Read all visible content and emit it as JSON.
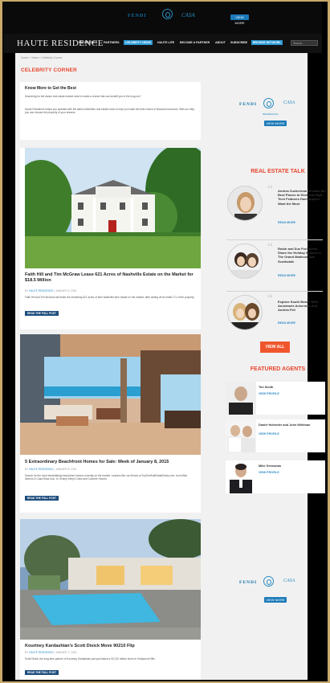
{
  "top_ad": {
    "brand_left": "FENDI",
    "brand_right": "CASA",
    "button": "VIEW MORE"
  },
  "header": {
    "brand": "HAUTE RESIDENCE",
    "nav": [
      "PROPERTIES",
      "PARTNERS",
      "CELEBRITY NEWS",
      "HAUTE LIFE",
      "BECOME A PARTNER",
      "ABOUT",
      "SUBSCRIBE"
    ],
    "register": "BROWSE NETWORK",
    "search_placeholder": "Search..."
  },
  "breadcrumb": "Home > News > Celebrity Corner",
  "page_title": "CELEBRITY CORNER",
  "intro": {
    "heading": "Know More to Get the Best",
    "p1": "Searching for the dance real estate market need to make a choice that can benefit you in the long run?",
    "p2": "Haute Residence keeps you updated with the latest celebrities real estate news to help you make the best choice of financial resources. With our help, you can choose the property of your dreams."
  },
  "articles": [
    {
      "title": "Faith Hill and Tim McGraw Lease 621 Acres of Nashville Estate on the Market for $18.5 Million",
      "by": "BY",
      "author": "HAUTE RESIDENCE",
      "date": "| JANUARY 8, 2015",
      "excerpt": "Faith Hill and Tim McGraw will lease the remaining 621 acres of their Nashville farm estate on the market, after selling off an initial 171 of the property.",
      "button": "READ THE FULL POST"
    },
    {
      "title": "5 Extraordinary Beachfront Homes for Sale: Week of January 8, 2015",
      "by": "BY",
      "author": "HAUTE RESIDENCE",
      "date": "| JANUARY 8, 2015",
      "excerpt": "Search for the most breathtaking beachfront homes currently on the market. Leaders like our friends at TopTenRealEstateDeals.com, from Mike Morrow & Casa Rosa Icon, to Tommy Kirby's Cabo and Canover Homes.",
      "button": "READ THE FULL POST"
    },
    {
      "title": "Kourtney Kardashian's Scott Disick Move 90210 Flip",
      "by": "BY",
      "author": "HAUTE RESIDENCE",
      "date": "| JANUARY 7, 2015",
      "excerpt": "Scott Disick, the long-time partner of Kourtney Kardashian just purchased a 90,210 million home in Hollywood Hills.",
      "button": "READ THE FULL POST"
    }
  ],
  "side_ad": {
    "brand_left": "FENDI",
    "brand_right": "CASA",
    "sub": "RESIDENCES",
    "button": "VIEW MORE"
  },
  "real_estate_talk": {
    "title": "REAL ESTATE TALK",
    "items": [
      {
        "headline": "Andrea Zuckerman Reveals the Best Places to Dine and High-Tech Features Homebuyers Want the Most",
        "more": "READ MORE"
      },
      {
        "headline": "Robin and Sue Forlemend Share the Holiday Season in The Grand Madison Spa Scottsdale",
        "more": "READ MORE"
      },
      {
        "headline": "Explore South Beach With Annemarie Ackerman and Andrea Fell",
        "more": "READ MORE"
      }
    ],
    "view_all": "VIEW ALL"
  },
  "featured_agents": {
    "title": "FEATURED AGENTS",
    "agents": [
      {
        "name": "Tim Smith",
        "more": "VIEW PROFILE"
      },
      {
        "name": "Daniel Hoherder and John Whitman",
        "more": "VIEW PROFILE"
      },
      {
        "name": "Mike Germanas",
        "more": "VIEW PROFILE"
      }
    ]
  },
  "bottom_ad": {
    "brand_left": "FENDI",
    "brand_right": "CASA",
    "button": "VIEW MORE"
  }
}
